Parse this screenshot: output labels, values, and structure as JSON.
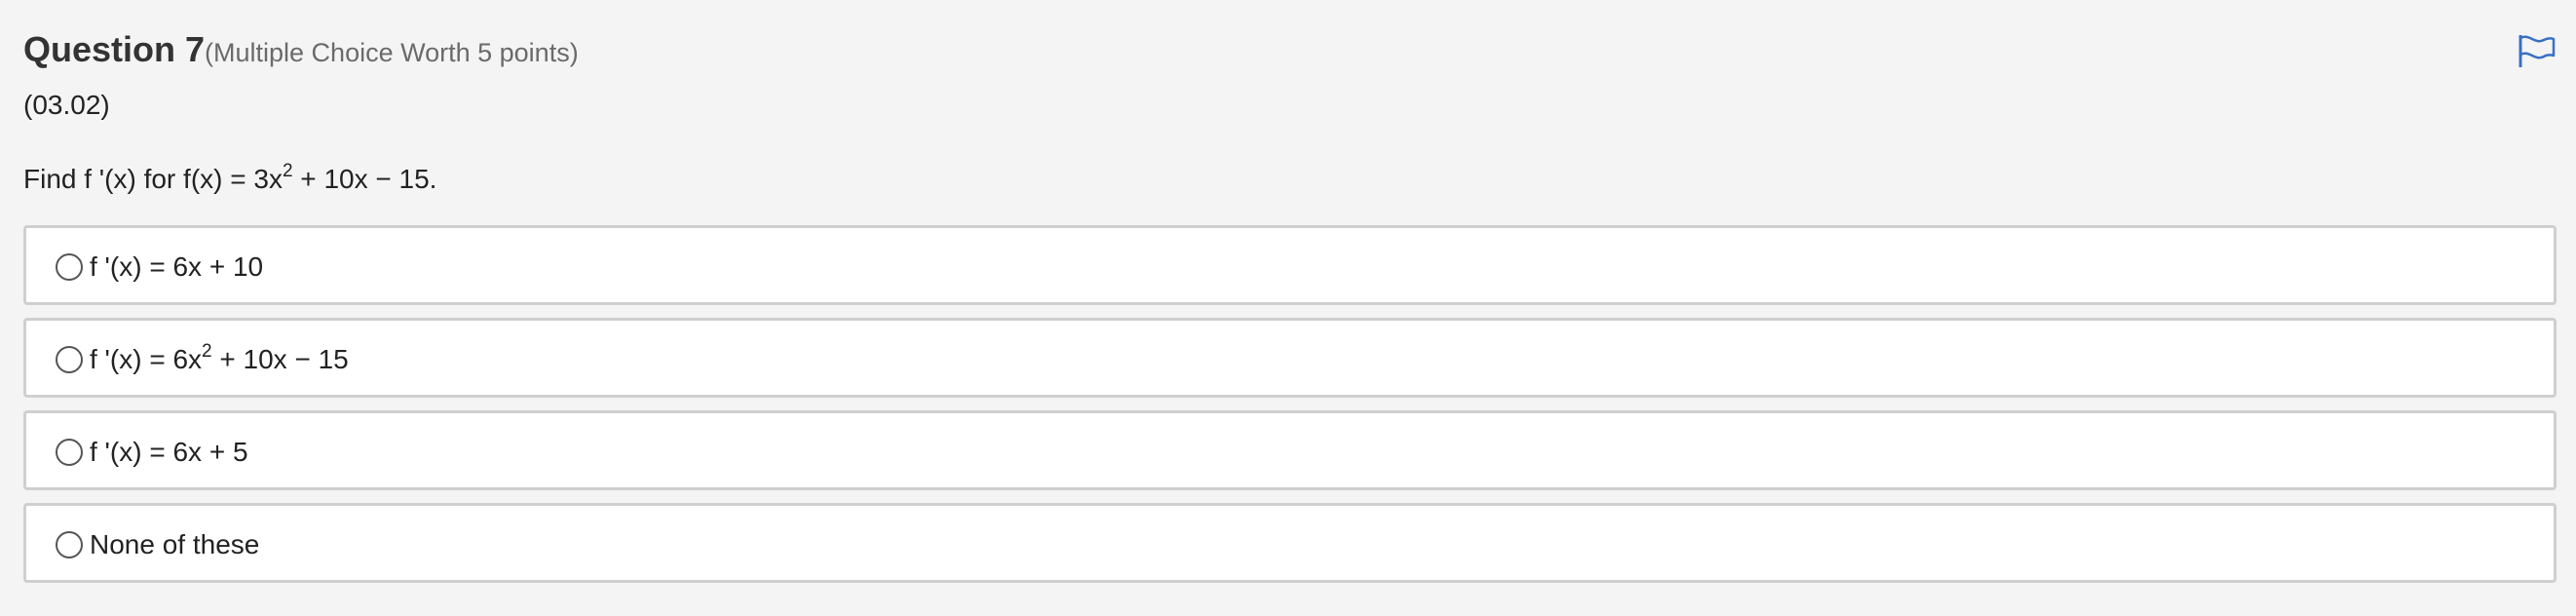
{
  "question": {
    "title": "Question 7",
    "worth": "(Multiple Choice Worth 5 points)",
    "code": "(03.02)",
    "prompt_before": "Find f '(x) for f(x) = 3x",
    "prompt_exp": "2",
    "prompt_after": " + 10x − 15.",
    "flag_icon": "flag-icon",
    "accent_color": "#3a6fc4"
  },
  "options": [
    {
      "before": "f '(x) = 6x + 10",
      "exp": "",
      "after": ""
    },
    {
      "before": "f '(x) = 6x",
      "exp": "2",
      "after": " + 10x − 15"
    },
    {
      "before": "f '(x) = 6x + 5",
      "exp": "",
      "after": ""
    },
    {
      "before": "None of these",
      "exp": "",
      "after": ""
    }
  ]
}
